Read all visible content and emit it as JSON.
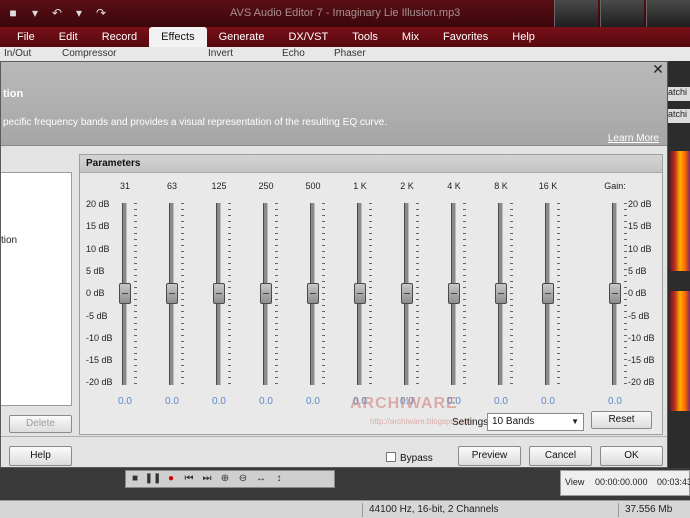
{
  "app": {
    "title": "AVS Audio Editor 7 - Imaginary Lie Illusion.mp3",
    "menu": [
      "File",
      "Edit",
      "Record",
      "Effects",
      "Generate",
      "DX/VST",
      "Tools",
      "Mix",
      "Favorites",
      "Help"
    ],
    "active_menu": "Effects",
    "ribbon": {
      "item1": "In/Out",
      "item2": "Compressor",
      "item3": "Invert",
      "item4": "Echo",
      "item5": "Phaser"
    },
    "right_tabs": [
      "atchi",
      "atchi"
    ]
  },
  "dialog": {
    "title": "tion",
    "description": "pecific frequency bands and provides a visual representation of the resulting EQ curve.",
    "learn_more": "Learn More",
    "left_panel_item": "tion",
    "delete_label": "Delete",
    "parameters_title": "Parameters",
    "db_labels": [
      "20 dB",
      "15 dB",
      "10 dB",
      "5 dB",
      "0 dB",
      "-5 dB",
      "-10 dB",
      "-15 dB",
      "-20 dB"
    ],
    "bands": [
      {
        "freq": "31",
        "value": "0.0"
      },
      {
        "freq": "63",
        "value": "0.0"
      },
      {
        "freq": "125",
        "value": "0.0"
      },
      {
        "freq": "250",
        "value": "0.0"
      },
      {
        "freq": "500",
        "value": "0.0"
      },
      {
        "freq": "1 K",
        "value": "0.0"
      },
      {
        "freq": "2 K",
        "value": "0.0"
      },
      {
        "freq": "4 K",
        "value": "0.0"
      },
      {
        "freq": "8 K",
        "value": "0.0"
      },
      {
        "freq": "16 K",
        "value": "0.0"
      }
    ],
    "gain": {
      "label": "Gain:",
      "value": "0.0"
    },
    "settings_label": "Settings",
    "settings_value": "10 Bands",
    "reset_label": "Reset",
    "help_label": "Help",
    "bypass_label": "Bypass",
    "preview_label": "Preview",
    "cancel_label": "Cancel",
    "ok_label": "OK",
    "watermark": "ARCHIWARE",
    "watermark_url": "http://archiware.blogspot.com"
  },
  "status": {
    "format": "44100 Hz, 16-bit, 2 Channels",
    "size": "37.556 Mb",
    "view_label": "View",
    "time1": "00:00:00.000",
    "time2": "00:03:43"
  }
}
